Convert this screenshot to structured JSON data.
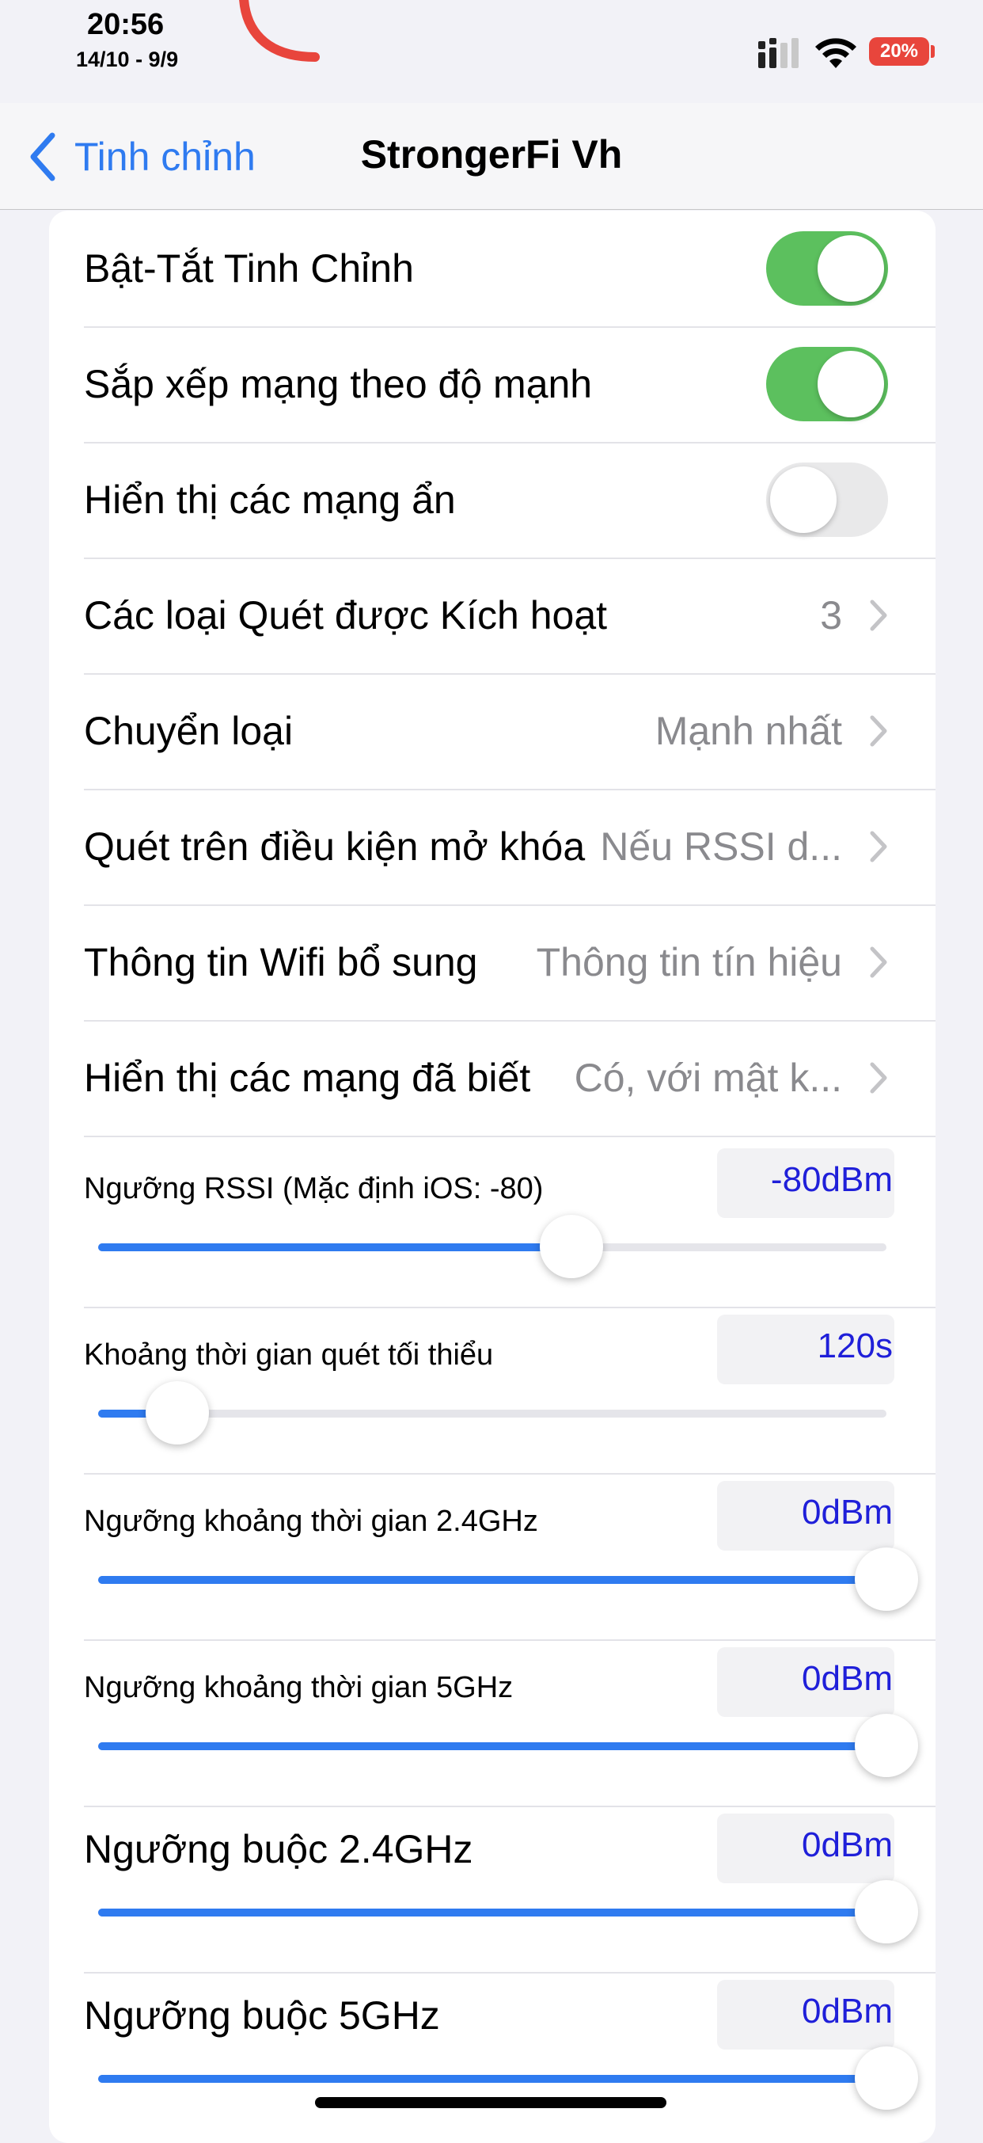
{
  "status": {
    "time": "20:56",
    "date": "14/10 - 9/9",
    "battery": "20%"
  },
  "nav": {
    "back_label": "Tinh chỉnh",
    "title": "StrongerFi Vh"
  },
  "colors": {
    "accent": "#2f7bf0",
    "toggle_on": "#5cc05e",
    "value_text": "#1f1fd9",
    "battery": "#e8453c"
  },
  "toggles": [
    {
      "label": "Bật-Tắt Tinh Chỉnh",
      "on": true
    },
    {
      "label": "Sắp xếp mạng theo độ mạnh",
      "on": true
    },
    {
      "label": "Hiển thị các mạng ẩn",
      "on": false
    }
  ],
  "links": [
    {
      "label": "Các loại Quét được Kích hoạt",
      "value": "3"
    },
    {
      "label": "Chuyển loại",
      "value": "Mạnh nhất"
    },
    {
      "label": "Quét trên điều kiện mở khóa",
      "value": "Nếu RSSI d..."
    },
    {
      "label": "Thông tin Wifi bổ sung",
      "value": "Thông tin tín hiệu"
    },
    {
      "label": "Hiển thị các mạng đã biết",
      "value": "Có, với mật k..."
    }
  ],
  "sliders": [
    {
      "label": "Ngưỡng RSSI (Mặc định iOS: -80)",
      "value": "-80dBm",
      "fraction": 0.6
    },
    {
      "label": "Khoảng thời gian quét tối thiểu",
      "value": "120s",
      "fraction": 0.1
    },
    {
      "label": "Ngưỡng khoảng thời gian 2.4GHz",
      "value": "0dBm",
      "fraction": 1.0
    },
    {
      "label": "Ngưỡng khoảng thời gian 5GHz",
      "value": "0dBm",
      "fraction": 1.0
    },
    {
      "label": "Ngưỡng buộc 2.4GHz",
      "value": "0dBm",
      "fraction": 1.0
    },
    {
      "label": "Ngưỡng buộc 5GHz",
      "value": "0dBm",
      "fraction": 1.0
    }
  ]
}
